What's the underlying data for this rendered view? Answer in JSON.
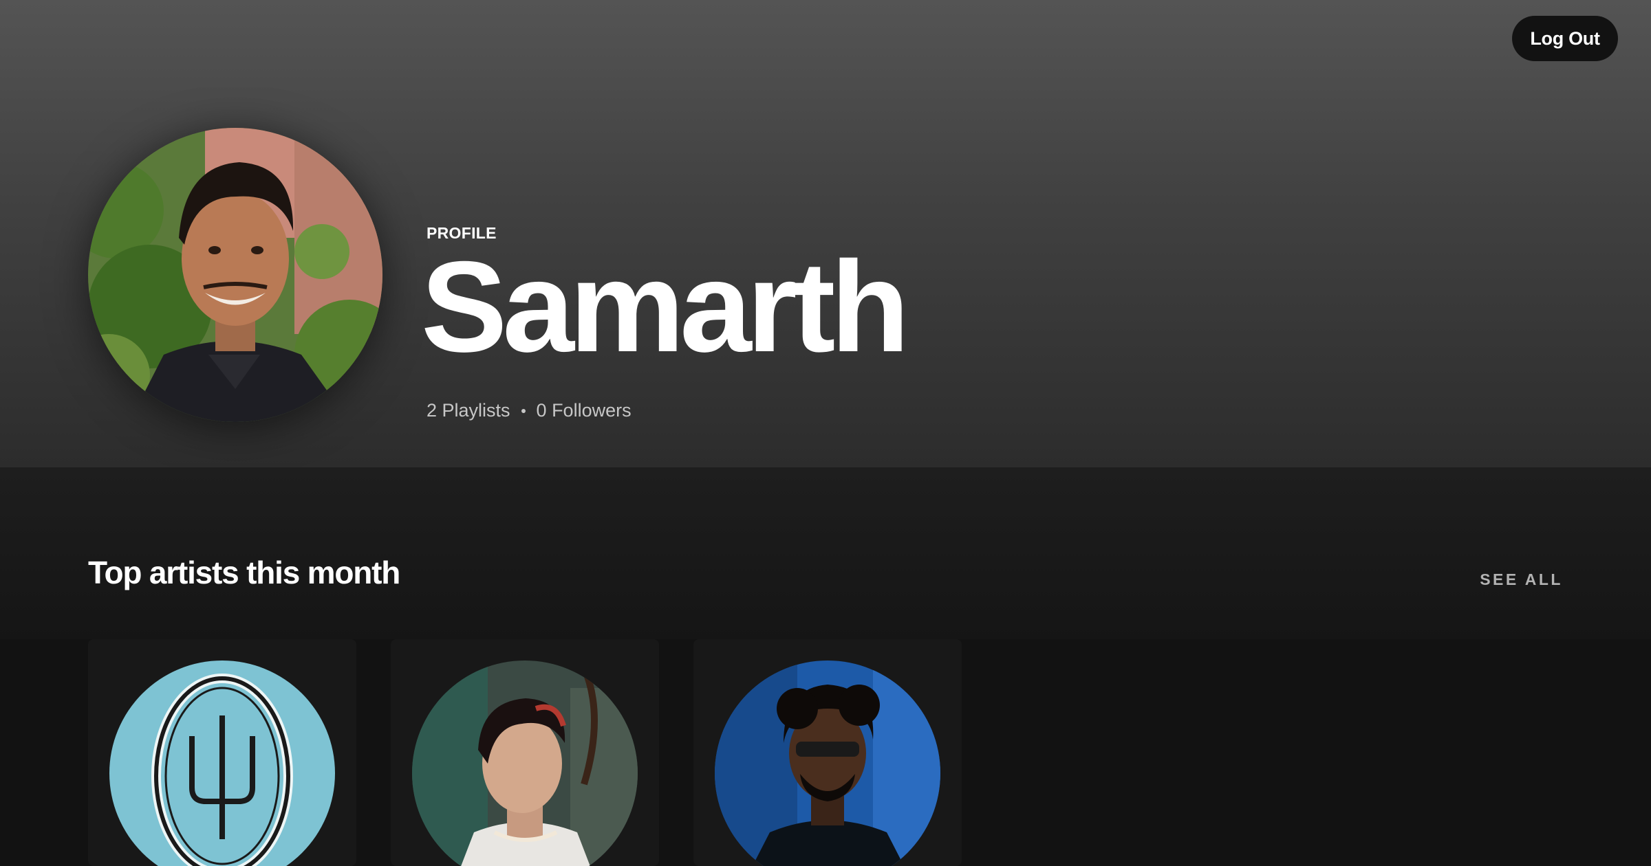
{
  "header": {
    "logout_label": "Log Out"
  },
  "profile": {
    "type_label": "PROFILE",
    "name": "Samarth",
    "playlists": "2 Playlists",
    "followers": "0 Followers"
  },
  "top_artists": {
    "title": "Top artists this month",
    "see_all_label": "SEE ALL",
    "artists": [
      {
        "image_icon": "trident-logo-icon",
        "bg_color": "#7ec3d3"
      },
      {
        "image_icon": "artist-portrait-icon",
        "bg_color": "#3b4a44"
      },
      {
        "image_icon": "artist-portrait-icon",
        "bg_color": "#1d5aa8"
      }
    ]
  },
  "colors": {
    "background": "#121212",
    "hero_top": "#545454",
    "button_bg": "#121212",
    "muted_text": "#b3b3b3"
  }
}
